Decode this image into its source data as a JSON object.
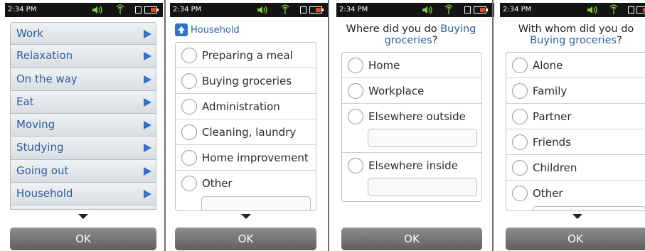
{
  "status": {
    "time": "2:34 PM",
    "icons": [
      "speaker-icon",
      "signal-icon",
      "phone-icon",
      "battery-icon"
    ],
    "battery_color": "#e6471c"
  },
  "screen1": {
    "menu": [
      {
        "label": "Work"
      },
      {
        "label": "Relaxation"
      },
      {
        "label": "On the way"
      },
      {
        "label": "Eat"
      },
      {
        "label": "Moving"
      },
      {
        "label": "Studying"
      },
      {
        "label": "Going out"
      },
      {
        "label": "Household"
      }
    ],
    "ok_label": "OK"
  },
  "screen2": {
    "breadcrumb": "Household",
    "options": [
      {
        "label": "Preparing a meal"
      },
      {
        "label": "Buying groceries"
      },
      {
        "label": "Administration"
      },
      {
        "label": "Cleaning, laundry"
      },
      {
        "label": "Home improvement"
      },
      {
        "label": "Other"
      }
    ],
    "ok_label": "OK"
  },
  "screen3": {
    "question_prefix": "Where did you do ",
    "question_highlight_1": "Buying",
    "question_highlight_2": "groceries",
    "question_suffix": "?",
    "options": [
      {
        "label": "Home"
      },
      {
        "label": "Workplace"
      },
      {
        "label": "Elsewhere outside"
      },
      {
        "label": "Elsewhere inside"
      }
    ],
    "ok_label": "OK"
  },
  "screen4": {
    "question_line1": "With whom did you do",
    "question_highlight": "Buying groceries",
    "question_suffix": "?",
    "options": [
      {
        "label": "Alone"
      },
      {
        "label": "Family"
      },
      {
        "label": "Partner"
      },
      {
        "label": "Friends"
      },
      {
        "label": "Children"
      },
      {
        "label": "Other"
      }
    ],
    "ok_label": "OK"
  },
  "colors": {
    "accent": "#2a5ea5",
    "arrow": "#2a72d4",
    "button": "#6f6f6f"
  }
}
